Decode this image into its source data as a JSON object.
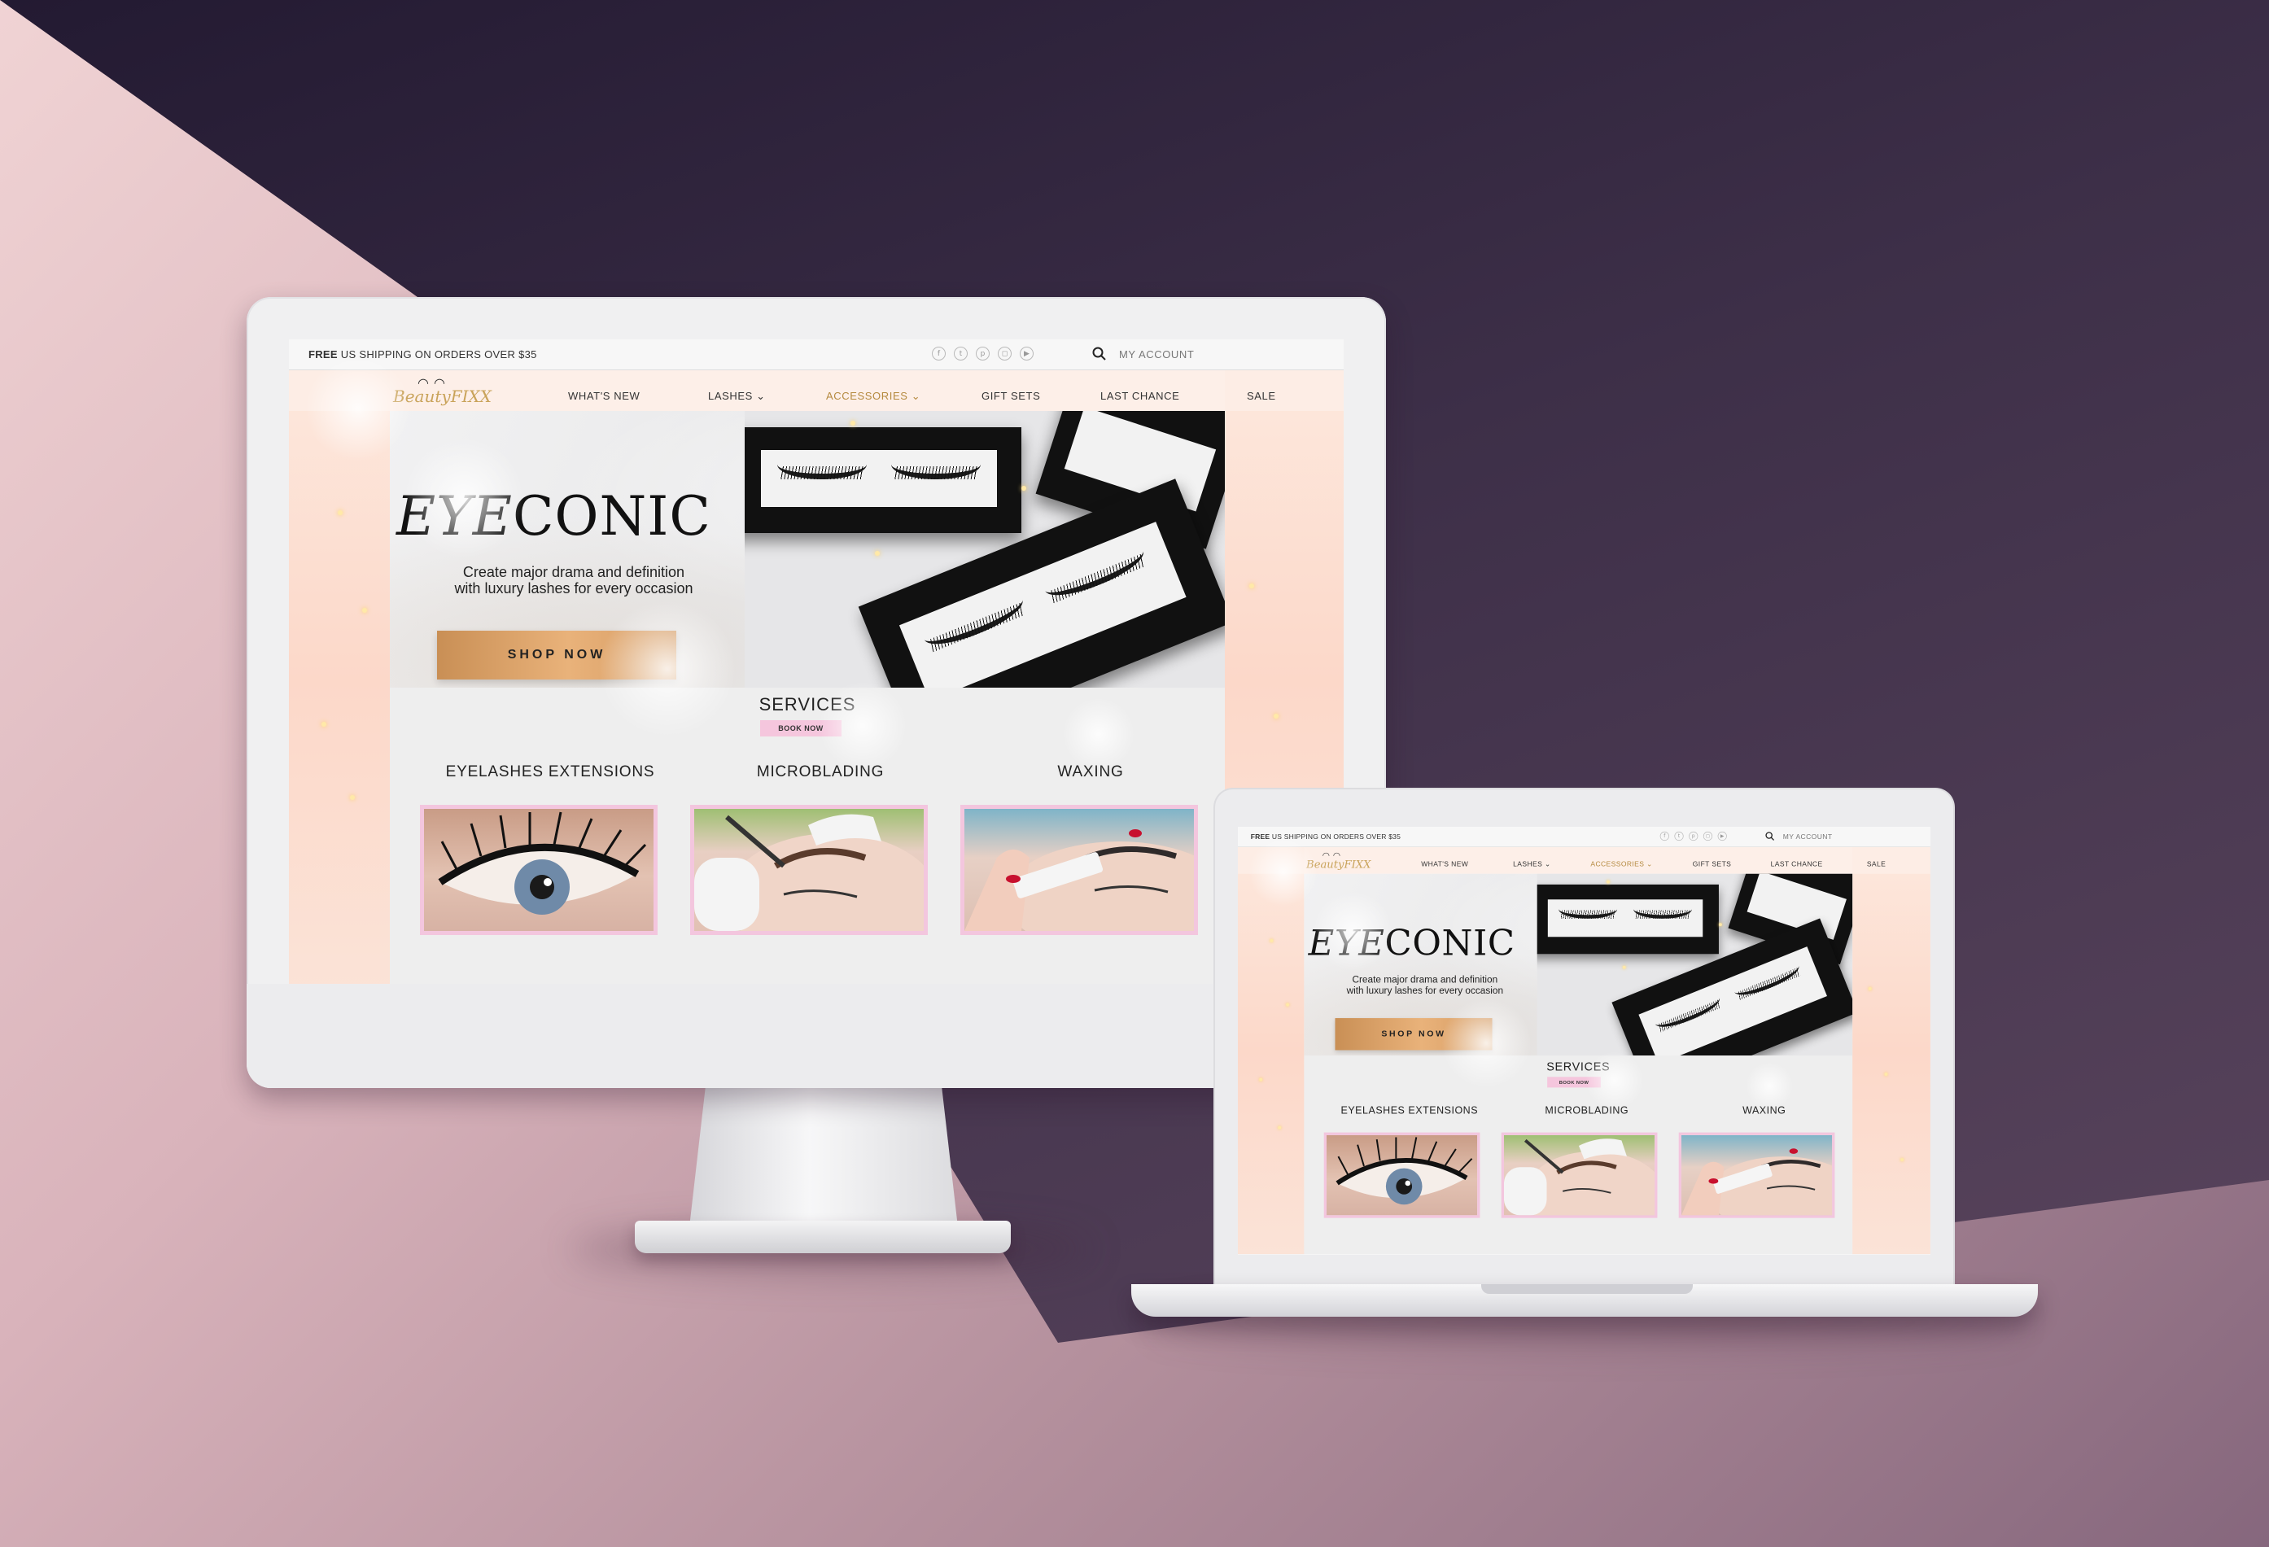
{
  "topbar": {
    "shipping_bold": "FREE",
    "shipping_rest": "US SHIPPING ON ORDERS OVER $35",
    "account": "MY ACCOUNT",
    "social_icons": [
      "facebook-icon",
      "twitter-icon",
      "pinterest-icon",
      "instagram-icon",
      "youtube-icon"
    ]
  },
  "logo": {
    "script": "Beauty",
    "caps": "FIXX"
  },
  "nav": {
    "whats_new": "WHAT'S NEW",
    "lashes": "LASHES ⌄",
    "accessories": "ACCESSORIES ⌄",
    "gift_sets": "GIFT SETS",
    "last_chance": "LAST CHANCE",
    "sale": "SALE"
  },
  "hero": {
    "title_italic": "EYE",
    "title_rest": "CONIC",
    "subtitle_line1": "Create major drama and definition",
    "subtitle_line2": "with luxury lashes for every occasion",
    "cta": "SHOP NOW"
  },
  "services": {
    "title": "SERVICES",
    "book": "BOOK NOW",
    "items": [
      {
        "name": "EYELASHES EXTENSIONS"
      },
      {
        "name": "MICROBLADING"
      },
      {
        "name": "WAXING"
      }
    ]
  },
  "colors": {
    "gold": "#c9a35a",
    "pink_badge": "#f5c6dd",
    "peach": "#fcd8c9",
    "cta_gold": "#e9b27a"
  }
}
